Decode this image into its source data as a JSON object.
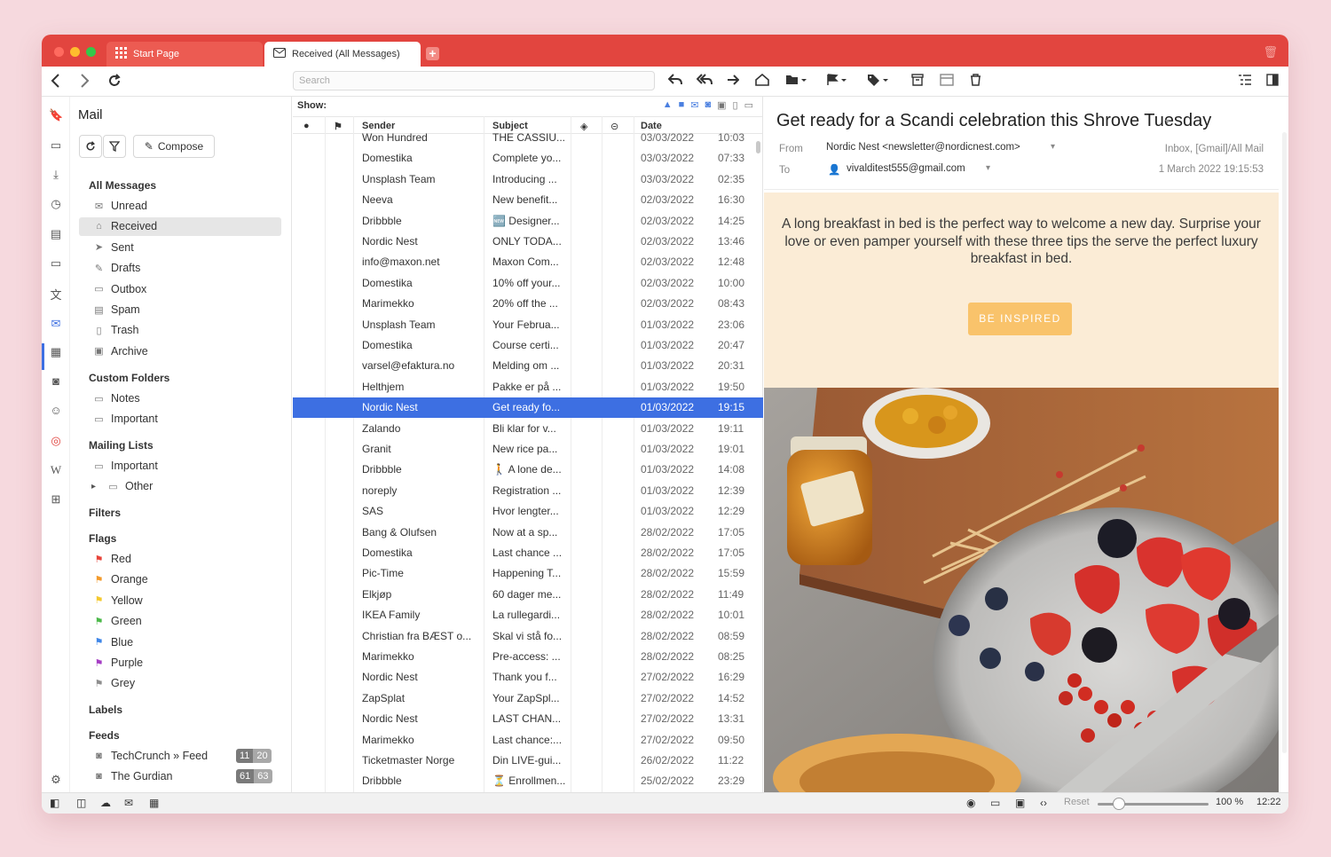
{
  "window": {
    "tabs": [
      {
        "label": "Start Page",
        "icon": "grid-icon"
      },
      {
        "label": "Received (All Messages)",
        "icon": "envelope-icon"
      }
    ],
    "traffic_lights": [
      "#ff6057",
      "#ffbd2e",
      "#28c940"
    ]
  },
  "toolbar": {
    "search_placeholder": "Search"
  },
  "mail_panel": {
    "title": "Mail",
    "compose_label": "Compose",
    "all_messages": "All Messages",
    "folders": [
      "Unread",
      "Received",
      "Sent",
      "Drafts",
      "Outbox",
      "Spam",
      "Trash",
      "Archive"
    ],
    "selected_folder": "Received",
    "custom_folders_title": "Custom Folders",
    "custom_folders": [
      "Notes",
      "Important"
    ],
    "mailing_lists_title": "Mailing Lists",
    "mailing_lists": [
      "Important",
      "Other"
    ],
    "filters_title": "Filters",
    "flags_title": "Flags",
    "flags": [
      {
        "label": "Red",
        "color": "#e8443a"
      },
      {
        "label": "Orange",
        "color": "#f39a2b"
      },
      {
        "label": "Yellow",
        "color": "#f5c92e"
      },
      {
        "label": "Green",
        "color": "#4cb94a"
      },
      {
        "label": "Blue",
        "color": "#3f86e8"
      },
      {
        "label": "Purple",
        "color": "#a53dc4"
      },
      {
        "label": "Grey",
        "color": "#8e8e8e"
      }
    ],
    "labels_title": "Labels",
    "feeds_title": "Feeds",
    "feeds": [
      {
        "label": "TechCrunch » Feed",
        "unread": "11",
        "total": "20"
      },
      {
        "label": "The Gurdian",
        "unread": "61",
        "total": "63"
      }
    ]
  },
  "message_list": {
    "show_label": "Show:",
    "columns": {
      "sender": "Sender",
      "subject": "Subject",
      "date": "Date"
    },
    "rows": [
      {
        "sender": "Won Hundred",
        "subject": "THE CASSIU...",
        "date": "03/03/2022",
        "time": "10:03"
      },
      {
        "sender": "Domestika",
        "subject": "Complete yo...",
        "date": "03/03/2022",
        "time": "07:33"
      },
      {
        "sender": "Unsplash Team",
        "subject": "Introducing ...",
        "date": "03/03/2022",
        "time": "02:35"
      },
      {
        "sender": "Neeva",
        "subject": "New benefit...",
        "date": "02/03/2022",
        "time": "16:30"
      },
      {
        "sender": "Dribbble",
        "subject": "🆕 Designer...",
        "date": "02/03/2022",
        "time": "14:25"
      },
      {
        "sender": "Nordic Nest",
        "subject": "ONLY TODA...",
        "date": "02/03/2022",
        "time": "13:46"
      },
      {
        "sender": "info@maxon.net",
        "subject": "Maxon Com...",
        "date": "02/03/2022",
        "time": "12:48"
      },
      {
        "sender": "Domestika",
        "subject": "10% off your...",
        "date": "02/03/2022",
        "time": "10:00"
      },
      {
        "sender": "Marimekko",
        "subject": "20% off the ...",
        "date": "02/03/2022",
        "time": "08:43"
      },
      {
        "sender": "Unsplash Team",
        "subject": "Your Februa...",
        "date": "01/03/2022",
        "time": "23:06"
      },
      {
        "sender": "Domestika",
        "subject": "Course certi...",
        "date": "01/03/2022",
        "time": "20:47"
      },
      {
        "sender": "varsel@efaktura.no",
        "subject": "Melding om ...",
        "date": "01/03/2022",
        "time": "20:31"
      },
      {
        "sender": "Helthjem",
        "subject": "Pakke er på ...",
        "date": "01/03/2022",
        "time": "19:50"
      },
      {
        "sender": "Nordic Nest",
        "subject": "Get ready fo...",
        "date": "01/03/2022",
        "time": "19:15",
        "selected": true
      },
      {
        "sender": "Zalando",
        "subject": "Bli klar for v...",
        "date": "01/03/2022",
        "time": "19:11"
      },
      {
        "sender": "Granit",
        "subject": "New rice pa...",
        "date": "01/03/2022",
        "time": "19:01"
      },
      {
        "sender": "Dribbble",
        "subject": "🚶 A lone de...",
        "date": "01/03/2022",
        "time": "14:08"
      },
      {
        "sender": "noreply",
        "subject": "Registration ...",
        "date": "01/03/2022",
        "time": "12:39"
      },
      {
        "sender": "SAS",
        "subject": "Hvor lengter...",
        "date": "01/03/2022",
        "time": "12:29"
      },
      {
        "sender": "Bang & Olufsen",
        "subject": "Now at a sp...",
        "date": "28/02/2022",
        "time": "17:05"
      },
      {
        "sender": "Domestika",
        "subject": "Last chance ...",
        "date": "28/02/2022",
        "time": "17:05"
      },
      {
        "sender": "Pic-Time",
        "subject": "Happening T...",
        "date": "28/02/2022",
        "time": "15:59"
      },
      {
        "sender": "Elkjøp",
        "subject": "60 dager me...",
        "date": "28/02/2022",
        "time": "11:49"
      },
      {
        "sender": "IKEA Family",
        "subject": "La rullegardi...",
        "date": "28/02/2022",
        "time": "10:01"
      },
      {
        "sender": "Christian fra BÆST o...",
        "subject": "Skal vi stå fo...",
        "date": "28/02/2022",
        "time": "08:59"
      },
      {
        "sender": "Marimekko",
        "subject": "Pre-access: ...",
        "date": "28/02/2022",
        "time": "08:25"
      },
      {
        "sender": "Nordic Nest",
        "subject": "Thank you f...",
        "date": "27/02/2022",
        "time": "16:29"
      },
      {
        "sender": "ZapSplat",
        "subject": "Your ZapSpl...",
        "date": "27/02/2022",
        "time": "14:52"
      },
      {
        "sender": "Nordic Nest",
        "subject": "LAST CHAN...",
        "date": "27/02/2022",
        "time": "13:31"
      },
      {
        "sender": "Marimekko",
        "subject": "Last chance:...",
        "date": "27/02/2022",
        "time": "09:50"
      },
      {
        "sender": "Ticketmaster Norge",
        "subject": "Din LIVE-gui...",
        "date": "26/02/2022",
        "time": "11:22"
      },
      {
        "sender": "Dribbble",
        "subject": "⏳ Enrollmen...",
        "date": "25/02/2022",
        "time": "23:29"
      }
    ]
  },
  "reader": {
    "subject": "Get ready for a Scandi celebration this Shrove Tuesday",
    "from_label": "From",
    "from": "Nordic Nest <newsletter@nordicnest.com>",
    "to_label": "To",
    "to": "vivalditest555@gmail.com",
    "folder": "Inbox, [Gmail]/All Mail",
    "date": "1 March 2022 19:15:53",
    "body_text": "A long breakfast in bed is the perfect way to welcome a new day. Surprise your love or even pamper yourself with these three tips the serve the perfect luxury breakfast in bed.",
    "cta": "BE INSPIRED",
    "accent": "#f9c36b",
    "banner_bg": "#fbecd6"
  },
  "statusbar": {
    "reset_label": "Reset",
    "zoom": "100 %",
    "clock": "12:22"
  },
  "colors": {
    "tabbar": "#e2453f",
    "selection": "#3d6fe2"
  }
}
